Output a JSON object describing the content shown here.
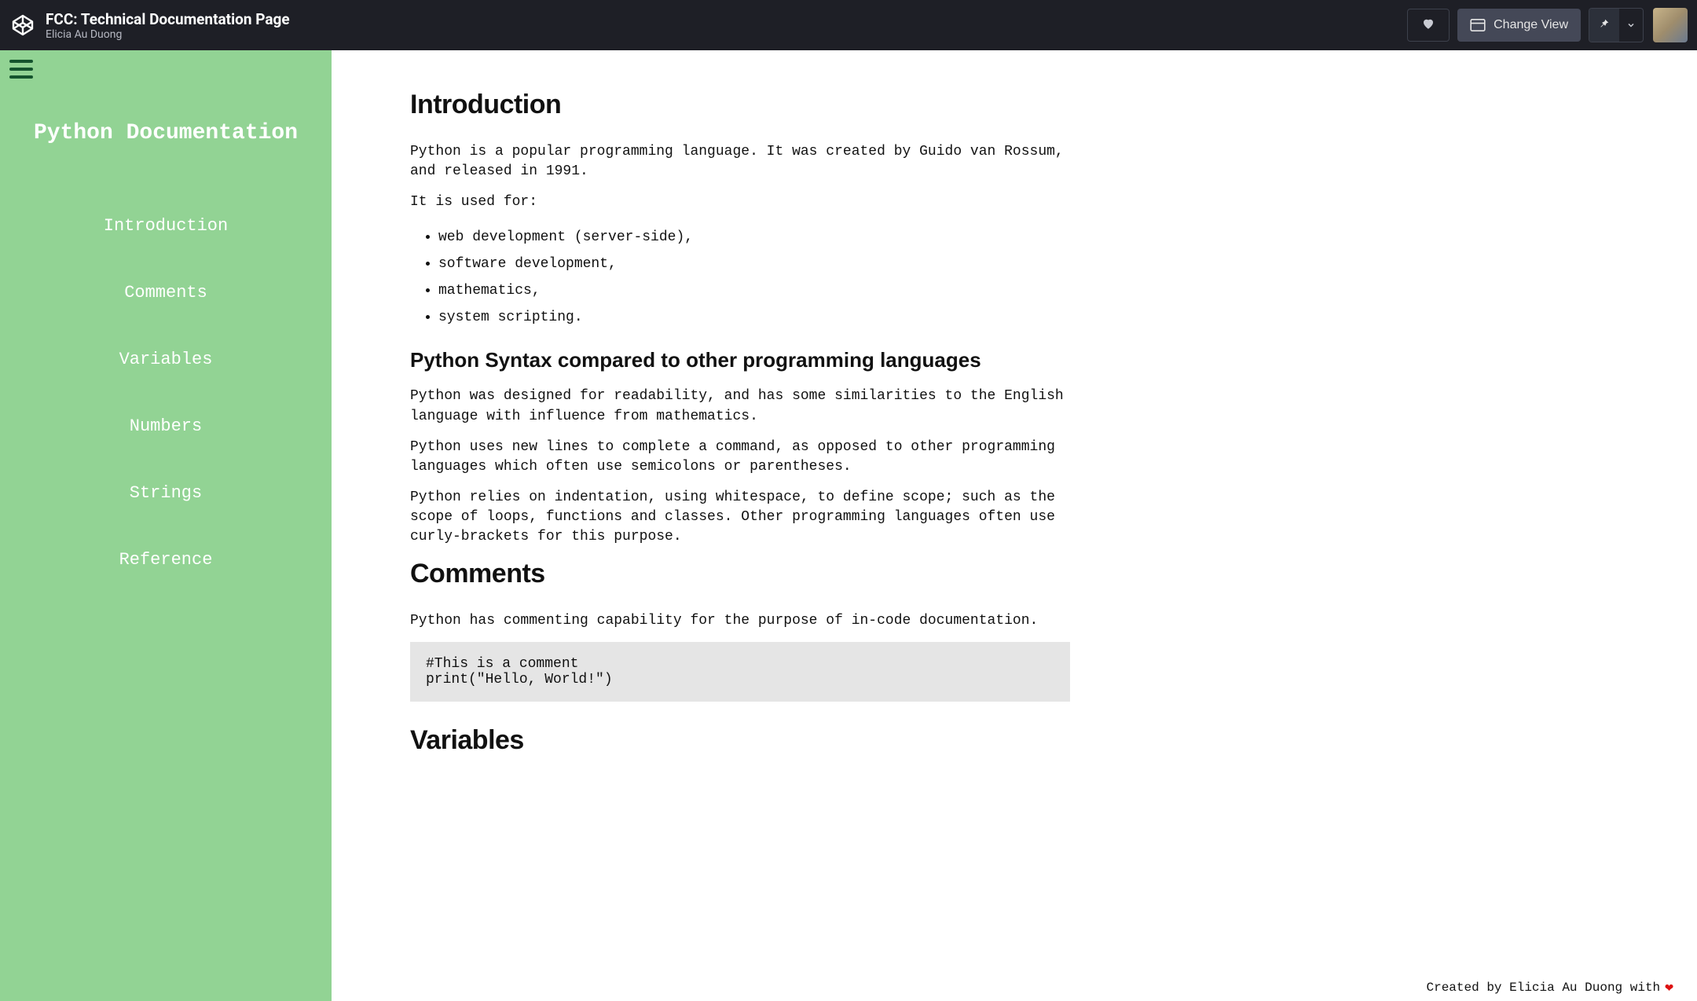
{
  "header": {
    "pen_title": "FCC: Technical Documentation Page",
    "pen_author": "Elicia Au Duong",
    "change_view_label": "Change View"
  },
  "sidebar": {
    "title": "Python Documentation",
    "items": [
      {
        "label": "Introduction"
      },
      {
        "label": "Comments"
      },
      {
        "label": "Variables"
      },
      {
        "label": "Numbers"
      },
      {
        "label": "Strings"
      },
      {
        "label": "Reference"
      }
    ]
  },
  "content": {
    "intro": {
      "heading": "Introduction",
      "p1": "Python is a popular programming language. It was created by Guido van Rossum, and released in 1991.",
      "p2": "It is used for:",
      "uses": [
        "web development (server-side),",
        "software development,",
        "mathematics,",
        "system scripting."
      ],
      "sub_heading": "Python Syntax compared to other programming languages",
      "sp1": "Python was designed for readability, and has some similarities to the English language with influence from mathematics.",
      "sp2": "Python uses new lines to complete a command, as opposed to other programming languages which often use semicolons or parentheses.",
      "sp3": "Python relies on indentation, using whitespace, to define scope; such as the scope of loops, functions and classes. Other programming languages often use curly-brackets for this purpose."
    },
    "comments": {
      "heading": "Comments",
      "p1": "Python has commenting capability for the purpose of in-code documentation.",
      "code": "#This is a comment\nprint(\"Hello, World!\")"
    },
    "variables": {
      "heading": "Variables"
    }
  },
  "footer": {
    "credit_text": "Created by Elicia Au Duong with"
  }
}
